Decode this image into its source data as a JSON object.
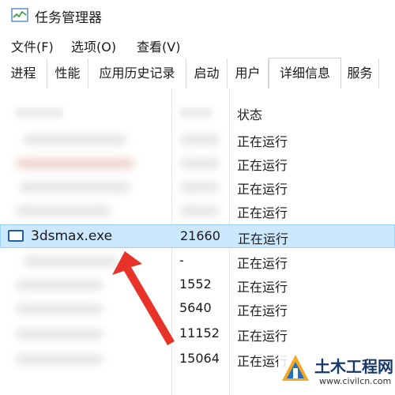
{
  "window": {
    "title": "任务管理器",
    "icon": "task-manager-icon"
  },
  "menu": [
    "文件(F)",
    "选项(O)",
    "查看(V)"
  ],
  "tabs": [
    "进程",
    "性能",
    "应用历史记录",
    "启动",
    "用户",
    "详细信息",
    "服务"
  ],
  "active_tab": "详细信息",
  "columns": {
    "status": "状态"
  },
  "rows": [
    {
      "name": "",
      "pid": "",
      "status": "正在运行"
    },
    {
      "name": "",
      "pid": "",
      "status": "正在运行"
    },
    {
      "name": "",
      "pid": "",
      "status": "正在运行"
    },
    {
      "name": "",
      "pid": "",
      "status": "正在运行"
    },
    {
      "name": "3dsmax.exe",
      "pid": "21660",
      "status": "正在运行",
      "selected": true
    },
    {
      "name": "",
      "pid": "-",
      "status": "正在运行"
    },
    {
      "name": "",
      "pid": "1552",
      "status": "正在运行"
    },
    {
      "name": "",
      "pid": "5640",
      "status": "正在运行"
    },
    {
      "name": "",
      "pid": "11152",
      "status": "正在运行"
    },
    {
      "name": "",
      "pid": "15064",
      "status": "正在运行"
    }
  ],
  "annotation": {
    "arrow_color": "#e8332a"
  },
  "watermark": {
    "title": "土木工程网",
    "url": "www.civilcn.com"
  },
  "colors": {
    "selection_bg": "#cce8ff",
    "selection_border": "#99d1ff",
    "accent": "#1f5fa8"
  }
}
